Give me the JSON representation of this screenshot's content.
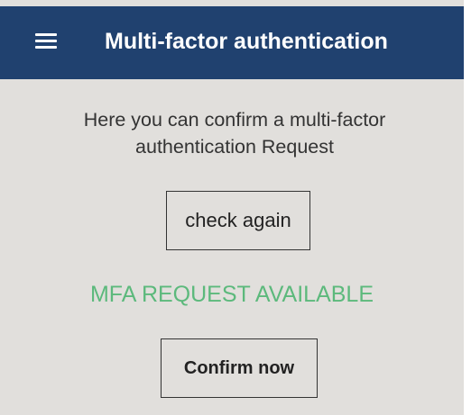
{
  "app_bar": {
    "title": "Multi-factor authentication",
    "menu_icon": "hamburger-menu-icon",
    "background_color": "#20416f"
  },
  "main": {
    "intro_text": "Here you can confirm a multi-factor authentication Request",
    "check_button_label": "check again",
    "status_text": "MFA REQUEST AVAILABLE",
    "status_color": "#5cb97c",
    "confirm_button_label": "Confirm now"
  }
}
